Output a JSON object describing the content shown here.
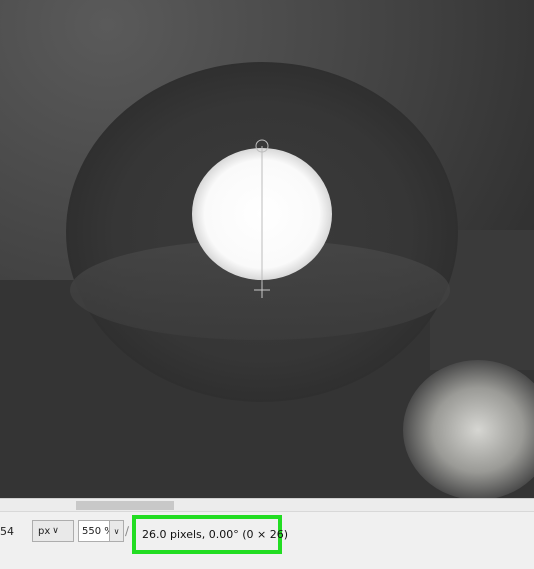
{
  "statusbar": {
    "coordinate": "54",
    "unit": "px",
    "zoom": "550 %",
    "measurement": "26.0 pixels, 0.00° (0 × 26)"
  },
  "icons": {
    "unit_dropdown": "chevron-down-icon",
    "zoom_dropdown": "chevron-down-icon",
    "measure_tool": "ruler-icon"
  },
  "colors": {
    "highlight": "#22dd22",
    "statusbar_bg": "#f0f0f0"
  }
}
